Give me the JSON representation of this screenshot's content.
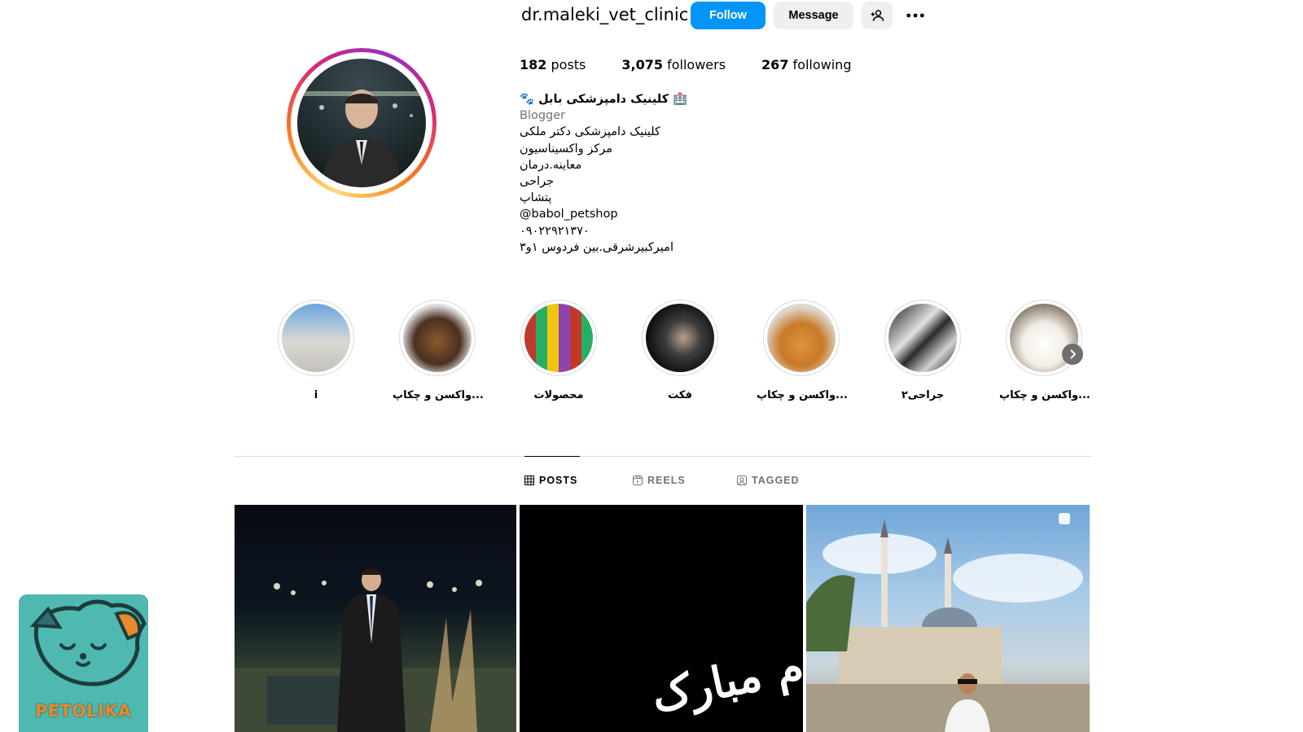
{
  "profile": {
    "username": "dr.maleki_vet_clinic",
    "follow_label": "Follow",
    "message_label": "Message"
  },
  "stats": {
    "posts_count": "182",
    "posts_label": "posts",
    "followers_count": "3,075",
    "followers_label": "followers",
    "following_count": "267",
    "following_label": "following"
  },
  "bio": {
    "name": "🐾 کلینیک دامپزشکی بابل 🏥",
    "category": "Blogger",
    "lines": [
      "کلینیک دامپزشکی دکتر ملکی",
      "مرکز واکسیناسیون",
      "معاینه.درمان",
      "جراحی",
      "پتشاپ",
      "@babol_petshop",
      "۰۹۰۲۲۹۲۱۳۷۰",
      "امیرکبیرشرقی.بین فردوس ۱و۳"
    ]
  },
  "highlights": [
    {
      "label": "i"
    },
    {
      "label": "واکسن و چکاپ..."
    },
    {
      "label": "محصولات"
    },
    {
      "label": "فکت"
    },
    {
      "label": "واکسن و چکاپ..."
    },
    {
      "label": "جراحی۲"
    },
    {
      "label": "واکسن و چکاپ..."
    }
  ],
  "tabs": {
    "posts": "POSTS",
    "reels": "REELS",
    "tagged": "TAGGED"
  },
  "posts": {
    "post2_caption": "تولدم مبارک"
  },
  "watermark": {
    "text": "PETOLIKA"
  },
  "colors": {
    "follow_blue": "#0095f6",
    "secondary_button": "#efefef",
    "muted_text": "#737373",
    "logo_teal": "#4fb8b0",
    "logo_orange": "#e98a2a"
  }
}
